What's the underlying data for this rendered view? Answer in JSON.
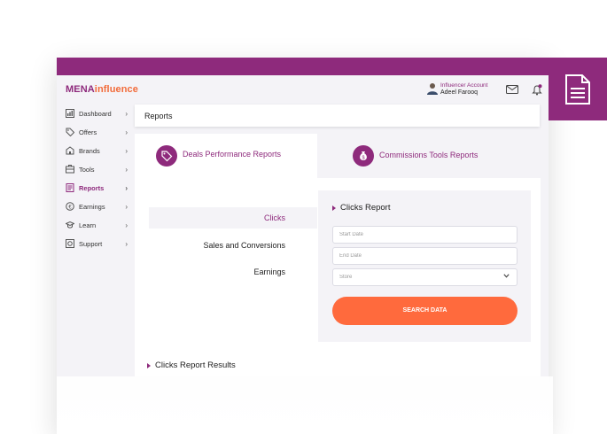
{
  "brand": {
    "name_part1": "MENA",
    "name_part2": "influence",
    "colors": {
      "primary": "#8e2a7c",
      "accent": "#ff6a3d",
      "logo_accent": "#f26b3a"
    }
  },
  "header": {
    "account_type": "Influencer Account",
    "user_name": "Adeel Farooq",
    "icons": [
      "avatar-icon",
      "mail-icon",
      "bell-icon"
    ]
  },
  "sidebar": {
    "items": [
      {
        "label": "Dashboard",
        "icon": "dashboard-icon"
      },
      {
        "label": "Offers",
        "icon": "tag-icon"
      },
      {
        "label": "Brands",
        "icon": "brands-icon"
      },
      {
        "label": "Tools",
        "icon": "tools-icon"
      },
      {
        "label": "Reports",
        "icon": "report-icon",
        "active": true
      },
      {
        "label": "Earnings",
        "icon": "earnings-icon"
      },
      {
        "label": "Learn",
        "icon": "learn-icon"
      },
      {
        "label": "Support",
        "icon": "support-icon"
      }
    ],
    "chevron": "›"
  },
  "breadcrumb": {
    "title": "Reports"
  },
  "tabs": {
    "deals": {
      "label": "Deals Performance Reports",
      "icon": "tag-icon",
      "active": true
    },
    "commissions": {
      "label": "Commissions Tools Reports",
      "icon": "money-bag-icon"
    }
  },
  "subnav": {
    "clicks": "Clicks",
    "sales": "Sales and Conversions",
    "earnings": "Earnings"
  },
  "form": {
    "title": "Clicks Report",
    "start_placeholder": "Start Date",
    "end_placeholder": "End Date",
    "store_placeholder": "Store",
    "search_label": "SEARCH DATA"
  },
  "results": {
    "title": "Clicks Report Results"
  },
  "badge": {
    "icon": "document-icon"
  }
}
